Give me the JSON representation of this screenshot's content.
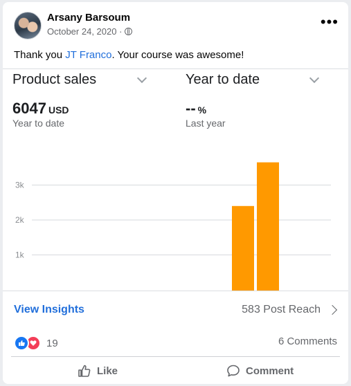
{
  "post": {
    "author": "Arsany Barsoum",
    "date": "October 24, 2020 ·",
    "message_prefix": "Thank you ",
    "mention": "JT Franco",
    "message_suffix": ". Your course was awesome!"
  },
  "screenshot": {
    "left_selector": "Product sales",
    "right_selector": "Year to date",
    "metric_value": "6047",
    "metric_unit": "USD",
    "metric_caption": "Year to date",
    "compare_value": "--",
    "compare_unit": "%",
    "compare_caption": "Last year"
  },
  "chart_data": {
    "type": "bar",
    "title": "",
    "xlabel": "",
    "ylabel": "",
    "yticks": [
      "3k",
      "2k",
      "1k"
    ],
    "ylim": [
      0,
      4000
    ],
    "categories": [
      "",
      ""
    ],
    "values": [
      2400,
      3650
    ],
    "grid": true,
    "colors": {
      "bar": "#ff9900"
    }
  },
  "footer": {
    "view_insights": "View Insights",
    "post_reach": "583 Post Reach",
    "reaction_count": "19",
    "comments": "6 Comments",
    "like_label": "Like",
    "comment_label": "Comment"
  },
  "icons": {
    "menu": "more-options-icon",
    "privacy": "globe-icon",
    "like": "thumbs-up-icon",
    "comment": "comment-bubble-icon"
  },
  "colors": {
    "link": "#216fdb",
    "like": "#1877f2",
    "love": "#f33e58",
    "bar": "#ff9900"
  }
}
